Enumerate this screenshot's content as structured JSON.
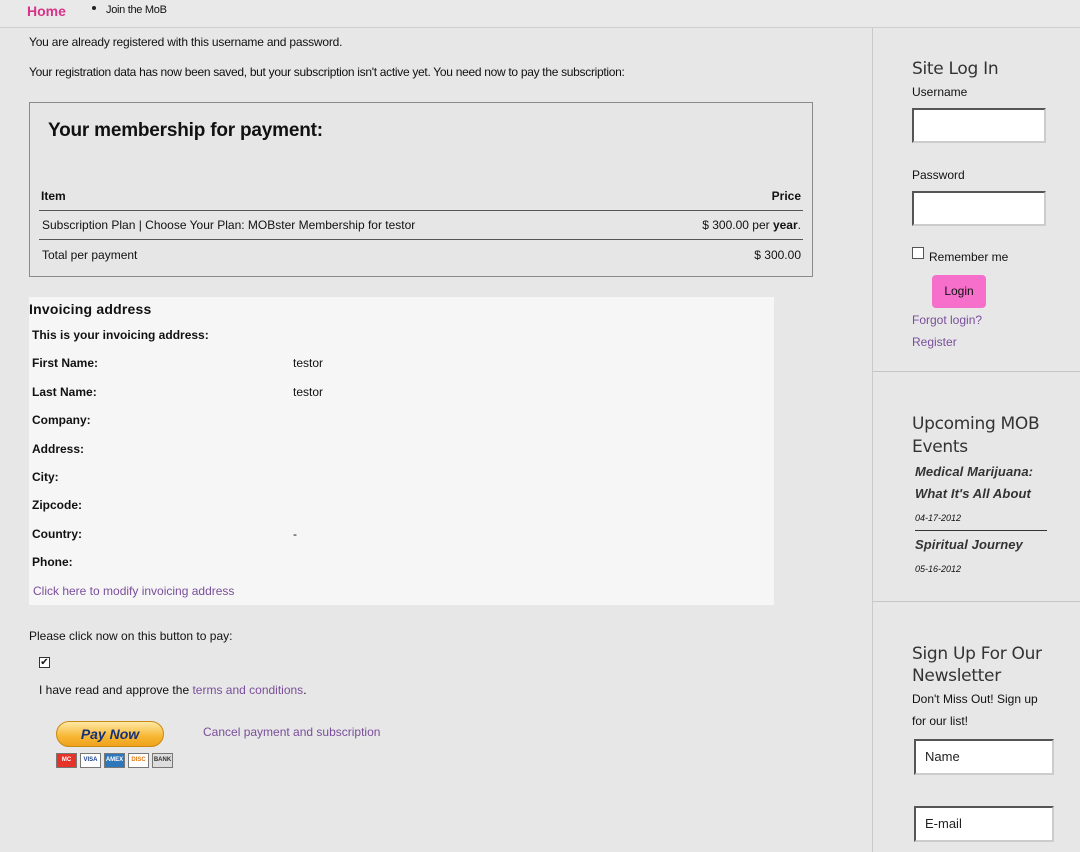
{
  "nav": {
    "home": "Home",
    "join": "Join the MoB"
  },
  "messages": {
    "registered": "You are already registered with this username and password.",
    "saved": "Your registration data has now been saved, but your subscription isn't active yet. You need now to pay the subscription:"
  },
  "membership": {
    "title": "Your membership for payment:",
    "col_item": "Item",
    "col_price": "Price",
    "item": "Subscription Plan | Choose Your Plan: MOBster Membership for testor",
    "price_amount": "$ 300.00 per",
    "price_period": "year",
    "price_end": ".",
    "total_label": "Total per payment",
    "total_price": "$ 300.00"
  },
  "invoice": {
    "title": "Invoicing address",
    "subtitle": "This is your invoicing address:",
    "fields": [
      {
        "label": "First Name:",
        "value": "testor"
      },
      {
        "label": "Last Name:",
        "value": "testor"
      },
      {
        "label": "Company:",
        "value": ""
      },
      {
        "label": "Address:",
        "value": ""
      },
      {
        "label": "City:",
        "value": ""
      },
      {
        "label": "Zipcode:",
        "value": ""
      },
      {
        "label": "Country:",
        "value": "-"
      },
      {
        "label": "Phone:",
        "value": ""
      }
    ],
    "modify_link": "Click here to modify invoicing address"
  },
  "payment": {
    "instruction": "Please click now on this button to pay:",
    "terms_checked": "✔",
    "terms_prefix": "I have read and approve the ",
    "terms_link": "terms and conditions",
    "terms_suffix": ".",
    "pay_button": "Pay Now",
    "cards": [
      "MC",
      "VISA",
      "AMEX",
      "DISC",
      "BANK"
    ],
    "cancel_link": "Cancel payment and subscription"
  },
  "sidebar": {
    "login": {
      "title": "Site Log In",
      "username_label": "Username",
      "password_label": "Password",
      "remember_label": "Remember me",
      "login_button": "Login",
      "forgot_link": "Forgot login?",
      "register_link": "Register"
    },
    "events": {
      "title_line1": "Upcoming MOB",
      "title_line2": "Events",
      "items": [
        {
          "title_line1": "Medical Marijuana:",
          "title_line2": "What It's All About",
          "date": "04-17-2012"
        },
        {
          "title_line1": "Spiritual Journey",
          "date": "05-16-2012"
        }
      ]
    },
    "newsletter": {
      "title_line1": "Sign Up For Our",
      "title_line2": "Newsletter",
      "text": "Don't Miss Out! Sign up for our list!",
      "name_placeholder": "Name",
      "email_placeholder": "E-mail"
    }
  }
}
